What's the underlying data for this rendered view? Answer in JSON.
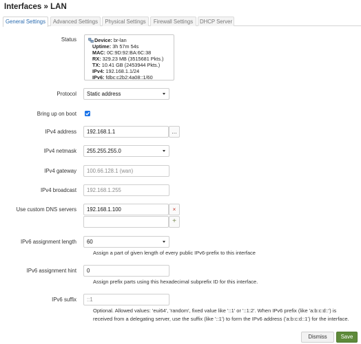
{
  "page_title": "Interfaces » LAN",
  "tabs": [
    {
      "label": "General Settings"
    },
    {
      "label": "Advanced Settings"
    },
    {
      "label": "Physical Settings"
    },
    {
      "label": "Firewall Settings"
    },
    {
      "label": "DHCP Server"
    }
  ],
  "status": {
    "label": "Status",
    "device_key": "Device:",
    "device_val": "br-lan",
    "uptime_key": "Uptime:",
    "uptime_val": "3h 57m 54s",
    "mac_key": "MAC:",
    "mac_val": "0C:9D:92:BA:6C:38",
    "rx_key": "RX:",
    "rx_val": "329.23 MB (3515681 Pkts.)",
    "tx_key": "TX:",
    "tx_val": "10.41 GB (2453944 Pkts.)",
    "ipv4_key": "IPv4:",
    "ipv4_val": "192.168.1.1/24",
    "ipv6_key": "IPv6:",
    "ipv6_val": "fdbc:c2b2:4a08::1/60"
  },
  "protocol": {
    "label": "Protocol",
    "value": "Static address"
  },
  "bring_up": {
    "label": "Bring up on boot",
    "checked": true
  },
  "ipv4_address": {
    "label": "IPv4 address",
    "value": "192.168.1.1",
    "more": "..."
  },
  "ipv4_netmask": {
    "label": "IPv4 netmask",
    "value": "255.255.255.0"
  },
  "ipv4_gateway": {
    "label": "IPv4 gateway",
    "placeholder": "100.66.128.1 (wan)"
  },
  "ipv4_broadcast": {
    "label": "IPv4 broadcast",
    "placeholder": "192.168.1.255"
  },
  "dns": {
    "label": "Use custom DNS servers",
    "value": "192.168.1.100",
    "remove": "×",
    "add": "+"
  },
  "ipv6_assign_len": {
    "label": "IPv6 assignment length",
    "value": "60",
    "desc": "Assign a part of given length of every public IPv6-prefix to this interface"
  },
  "ipv6_assign_hint": {
    "label": "IPv6 assignment hint",
    "value": "0",
    "desc": "Assign prefix parts using this hexadecimal subprefix ID for this interface."
  },
  "ipv6_suffix": {
    "label": "IPv6 suffix",
    "value": "::1",
    "desc_line1": "Optional. Allowed values: 'eui64', 'random', fixed value like '::1' or '::1:2'. When IPv6 prefix (like 'a:b:c:d::') is",
    "desc_line2": "received from a delegating server, use the suffix (like '::1') to form the IPv6 address ('a:b:c:d::1') for the interface."
  },
  "footer": {
    "dismiss": "Dismiss",
    "save": "Save"
  },
  "colors": {
    "accent": "#2b6cb0",
    "checkbox": "#1a73e8",
    "save": "#5e8a3a",
    "remove": "#c0392b"
  }
}
